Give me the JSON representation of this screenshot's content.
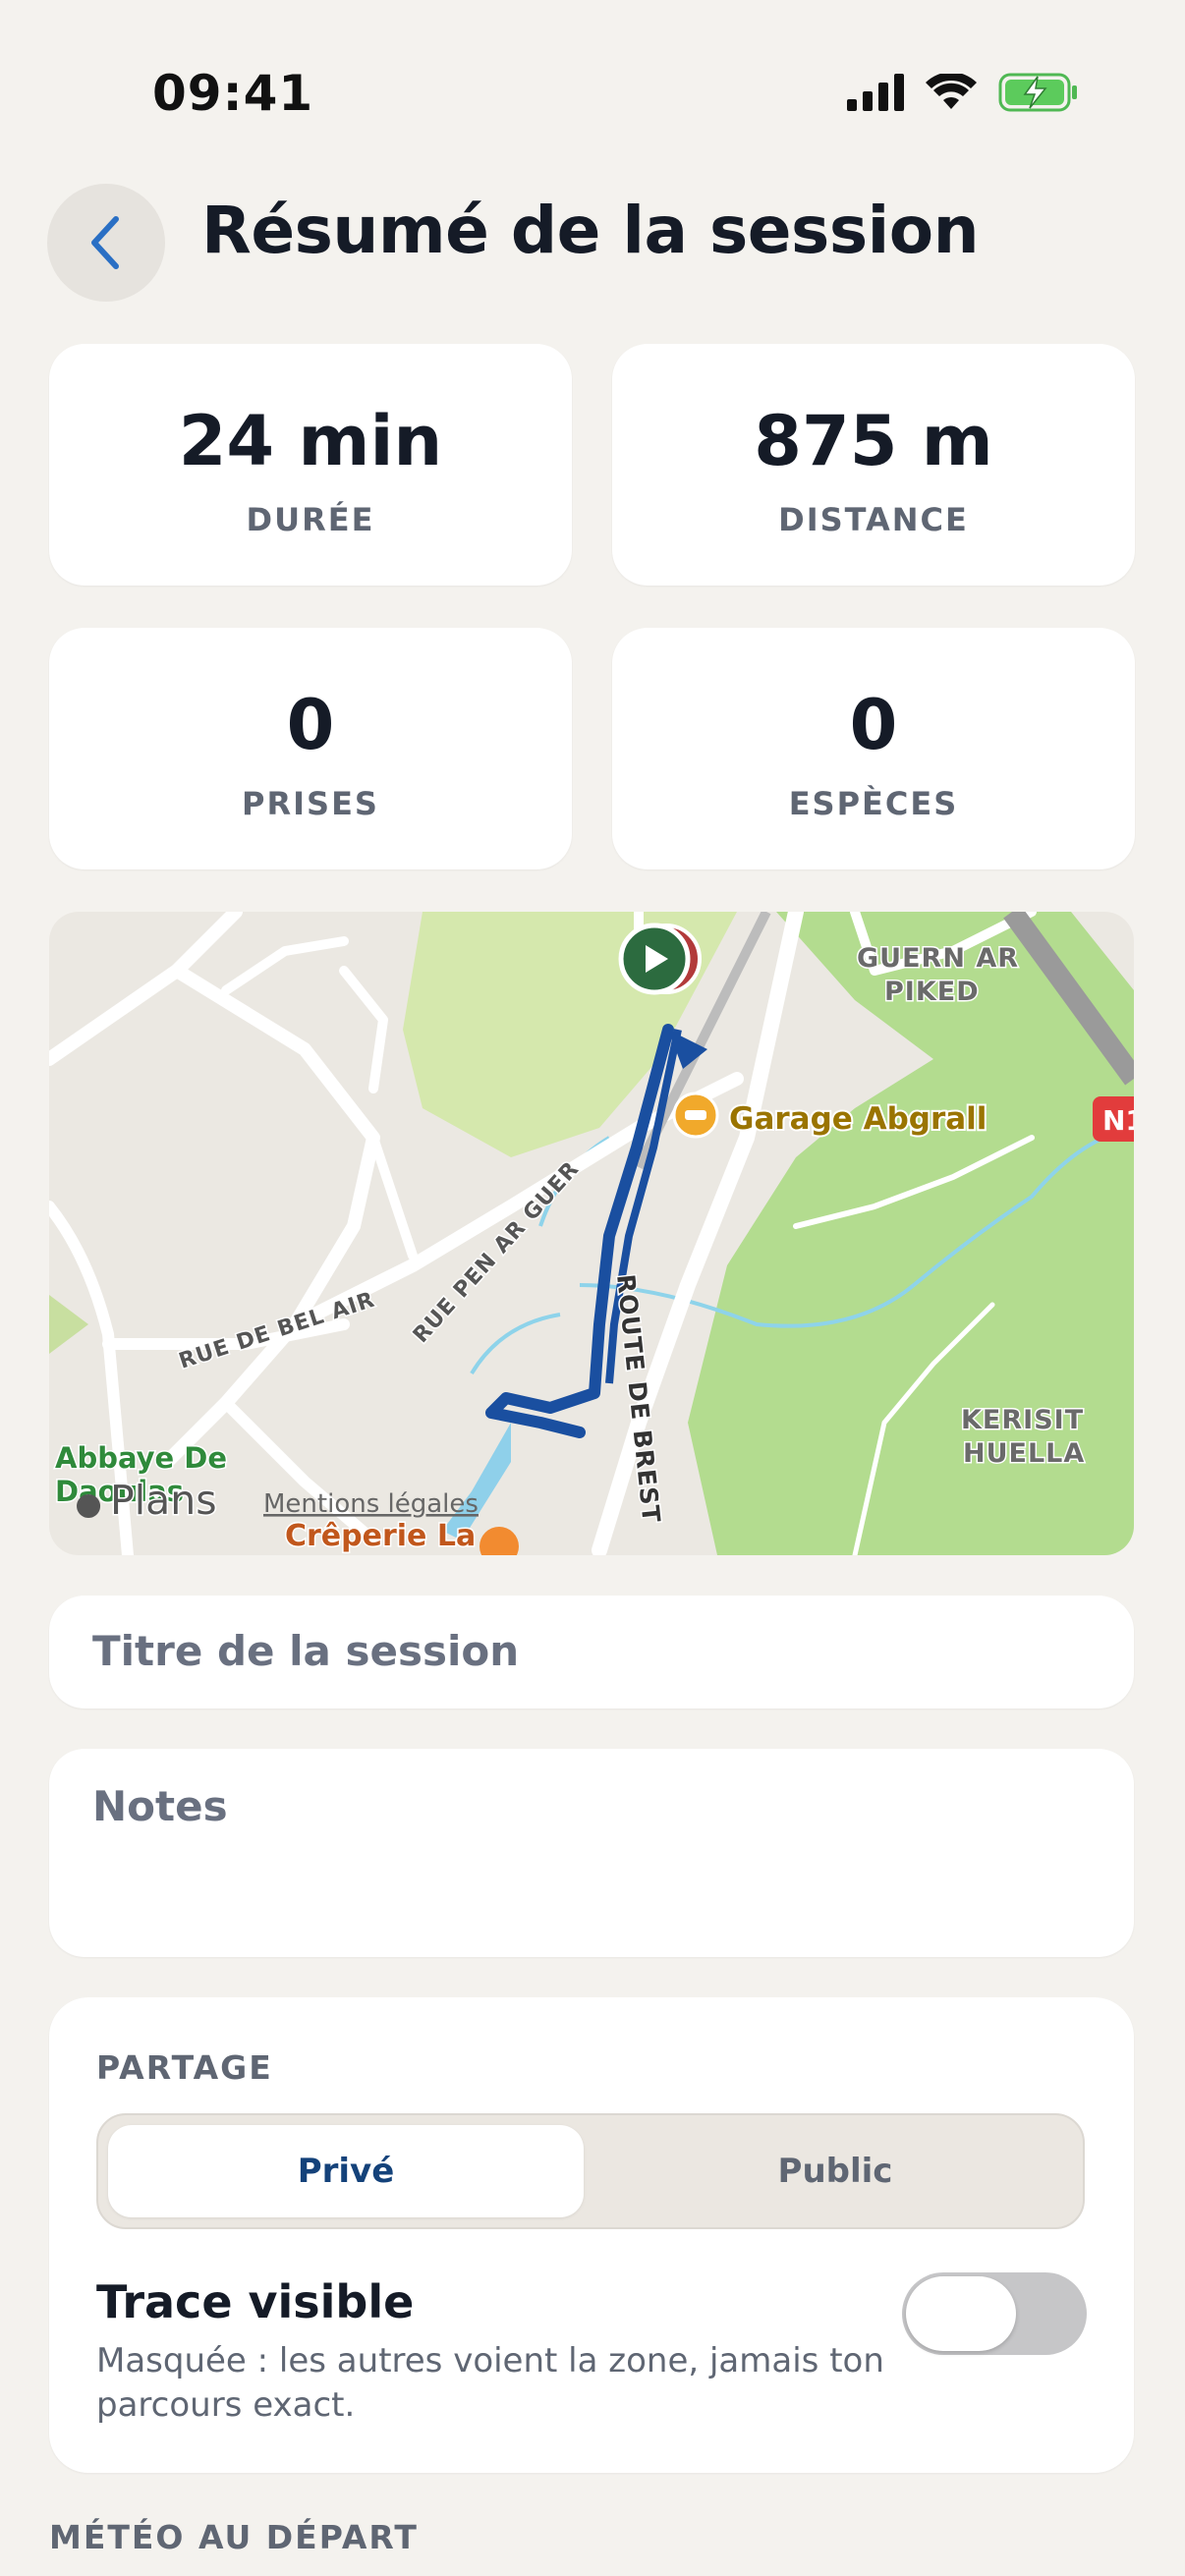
{
  "status": {
    "time": "09:41"
  },
  "header": {
    "title": "Résumé de la session"
  },
  "stats": [
    {
      "value": "24 min",
      "label": "DURÉE"
    },
    {
      "value": "875 m",
      "label": "DISTANCE"
    },
    {
      "value": "0",
      "label": "PRISES"
    },
    {
      "value": "0",
      "label": "ESPÈCES"
    }
  ],
  "map": {
    "labels": {
      "guern": "GUERN AR",
      "piked": "PIKED",
      "garage": "Garage Abgrall",
      "route_badge": "N1",
      "rue_pen_ar_guer": "RUE PEN AR GUER",
      "rue_de_bel_air": "RUE DE BEL AIR",
      "route_de_brest": "ROUTE DE BREST",
      "kerisit": "KERISIT",
      "huella": "HUELLA",
      "abbaye_1": "Abbaye De",
      "abbaye_2": "Daoulas",
      "plans": "Plans",
      "mentions": "Mentions légales",
      "creperie": "Crêperie La"
    }
  },
  "form": {
    "title_placeholder": "Titre de la session",
    "notes_placeholder": "Notes"
  },
  "sharing": {
    "heading": "PARTAGE",
    "options": [
      "Privé",
      "Public"
    ],
    "selected": "Privé",
    "trace_title": "Trace visible",
    "trace_desc": "Masquée : les autres voient la zone, jamais ton parcours exact.",
    "trace_visible": false
  },
  "weather": {
    "heading": "MÉTÉO AU DÉPART"
  },
  "colors": {
    "accent": "#14427a",
    "track": "#1a4fa0",
    "start_marker": "#2c6b3f"
  }
}
